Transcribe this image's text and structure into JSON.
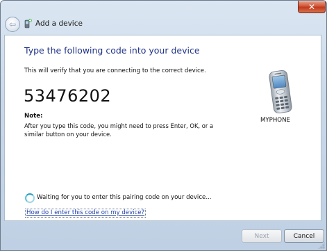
{
  "window": {
    "close_glyph": "✕"
  },
  "header": {
    "back_glyph": "⇦",
    "title": "Add a device",
    "icon": "add-device-wizard-icon"
  },
  "content": {
    "heading": "Type the following code into your device",
    "subtext": "This will verify that you are connecting to the correct device.",
    "code": "53476202",
    "note_label": "Note:",
    "note_text": "After you type this code, you might need to press Enter, OK, or a similar button on your device.",
    "device_icon": "mobile-phone-icon",
    "device_name": "MYPHONE",
    "status": "Waiting for you to enter this pairing code on your device...",
    "help_link": "How do I enter this code on my device?"
  },
  "footer": {
    "next_label": "Next",
    "cancel_label": "Cancel"
  },
  "colors": {
    "heading": "#1e3287",
    "link": "#1f3fa8",
    "close_button": "#c23a1c"
  }
}
